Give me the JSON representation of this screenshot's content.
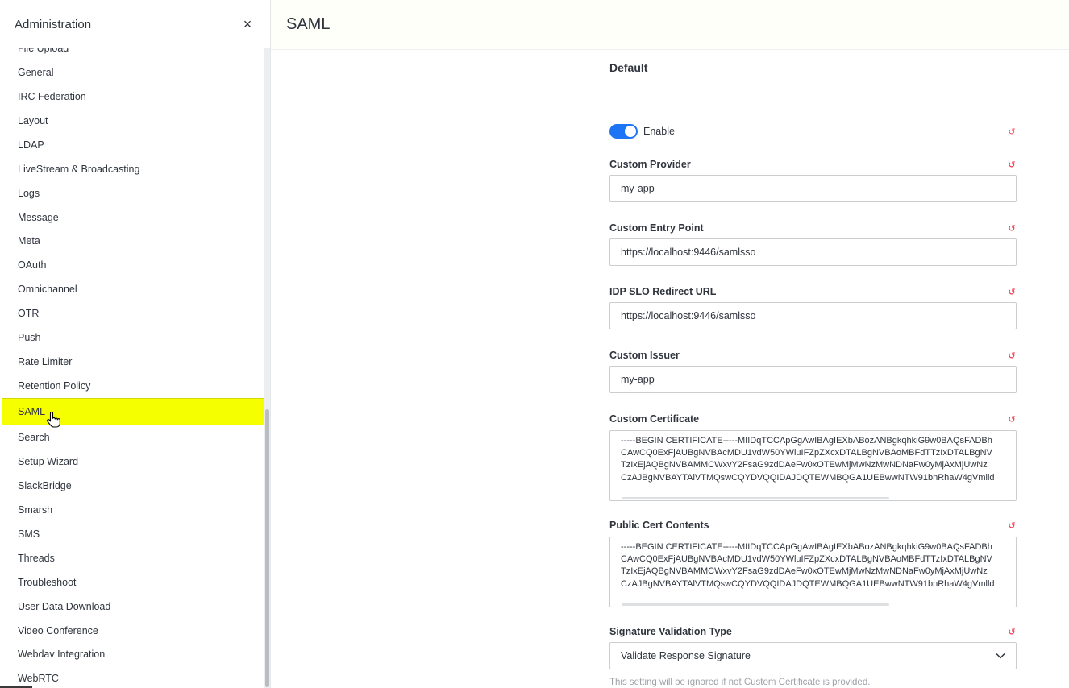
{
  "sidebar": {
    "title": "Administration",
    "close_label": "×",
    "items": [
      {
        "label": "File Upload"
      },
      {
        "label": "General"
      },
      {
        "label": "IRC Federation"
      },
      {
        "label": "Layout"
      },
      {
        "label": "LDAP"
      },
      {
        "label": "LiveStream & Broadcasting"
      },
      {
        "label": "Logs"
      },
      {
        "label": "Message"
      },
      {
        "label": "Meta"
      },
      {
        "label": "OAuth"
      },
      {
        "label": "Omnichannel"
      },
      {
        "label": "OTR"
      },
      {
        "label": "Push"
      },
      {
        "label": "Rate Limiter"
      },
      {
        "label": "Retention Policy"
      },
      {
        "label": "SAML",
        "active": true
      },
      {
        "label": "Search"
      },
      {
        "label": "Setup Wizard"
      },
      {
        "label": "SlackBridge"
      },
      {
        "label": "Smarsh"
      },
      {
        "label": "SMS"
      },
      {
        "label": "Threads"
      },
      {
        "label": "Troubleshoot"
      },
      {
        "label": "User Data Download"
      },
      {
        "label": "Video Conference"
      },
      {
        "label": "Webdav Integration"
      },
      {
        "label": "WebRTC"
      }
    ]
  },
  "main": {
    "page_title": "SAML",
    "section_title": "Default",
    "enable": {
      "label": "Enable",
      "checked": true
    },
    "fields": {
      "custom_provider": {
        "label": "Custom Provider",
        "value": "my-app"
      },
      "custom_entry_point": {
        "label": "Custom Entry Point",
        "value": "https://localhost:9446/samlsso"
      },
      "idp_slo_redirect_url": {
        "label": "IDP SLO Redirect URL",
        "value": "https://localhost:9446/samlsso"
      },
      "custom_issuer": {
        "label": "Custom Issuer",
        "value": "my-app"
      },
      "custom_certificate": {
        "label": "Custom Certificate",
        "lines": [
          "-----BEGIN CERTIFICATE-----MIIDqTCCApGgAwIBAgIEXbABozANBgkqhkiG9w0BAQsFADBh",
          "CAwCQ0ExFjAUBgNVBAcMDU1vdW50YWluIFZpZXcxDTALBgNVBAoMBFdTTzIxDTALBgNV",
          "TzIxEjAQBgNVBAMMCWxvY2FsaG9zdDAeFw0xOTEwMjMwNzMwNDNaFw0yMjAxMjUwNz",
          "CzAJBgNVBAYTAlVTMQswCQYDVQQIDAJDQTEWMBQGA1UEBwwNTW91bnRhaW4gVmlld"
        ]
      },
      "public_cert_contents": {
        "label": "Public Cert Contents",
        "lines": [
          "-----BEGIN CERTIFICATE-----MIIDqTCCApGgAwIBAgIEXbABozANBgkqhkiG9w0BAQsFADBh",
          "CAwCQ0ExFjAUBgNVBAcMDU1vdW50YWluIFZpZXcxDTALBgNVBAoMBFdTTzIxDTALBgNV",
          "TzIxEjAQBgNVBAMMCWxvY2FsaG9zdDAeFw0xOTEwMjMwNzMwNDNaFw0yMjAxMjUwNz",
          "CzAJBgNVBAYTAlVTMQswCQYDVQQIDAJDQTEWMBQGA1UEBwwNTW91bnRhaW4gVmlld"
        ]
      },
      "signature_validation_type": {
        "label": "Signature Validation Type",
        "value": "Validate Response Signature",
        "hint": "This setting will be ignored if not Custom Certificate is provided."
      }
    }
  },
  "colors": {
    "active_item_bg": "#f6ff00",
    "toggle_on": "#1d74f5",
    "reset_icon": "#f5455c"
  },
  "icons": {
    "close": "close-icon",
    "reset": "reset-icon",
    "chevron": "chevron-down-icon",
    "cursor": "hand-pointer-icon"
  }
}
